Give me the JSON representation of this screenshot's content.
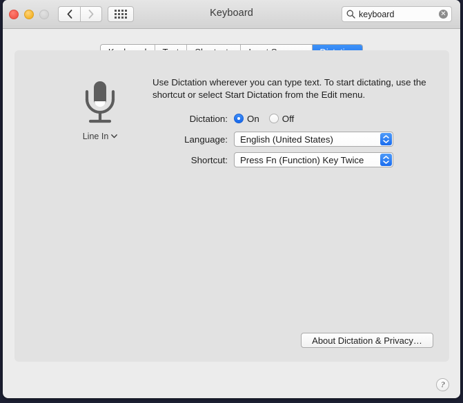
{
  "window": {
    "title": "Keyboard",
    "traffic_lights": [
      "close-button",
      "minimize-button",
      "zoom-button-disabled"
    ],
    "nav": {
      "back_icon": "chevron-left-icon",
      "forward_icon": "chevron-right-icon",
      "grid_icon": "show-all-grid-icon"
    },
    "search": {
      "icon": "search-icon",
      "value": "keyboard",
      "placeholder": "Search",
      "clear_icon": "clear-icon",
      "clear_glyph": "✕"
    }
  },
  "tabs": [
    {
      "label": "Keyboard",
      "active": false
    },
    {
      "label": "Text",
      "active": false
    },
    {
      "label": "Shortcuts",
      "active": false
    },
    {
      "label": "Input Sources",
      "active": false
    },
    {
      "label": "Dictation",
      "active": true
    }
  ],
  "main": {
    "description": "Use Dictation wherever you can type text. To start dictating, use the shortcut or select Start Dictation from the Edit menu.",
    "microphone": {
      "icon": "microphone-icon",
      "source_label": "Line In",
      "chevron": "⌄"
    },
    "fields": {
      "dictation": {
        "label": "Dictation:",
        "options": [
          {
            "label": "On",
            "selected": true
          },
          {
            "label": "Off",
            "selected": false
          }
        ]
      },
      "language": {
        "label": "Language:",
        "value": "English (United States)"
      },
      "shortcut": {
        "label": "Shortcut:",
        "value": "Press Fn (Function) Key Twice"
      }
    },
    "about_button": "About Dictation & Privacy…"
  },
  "help": {
    "label": "?"
  },
  "colors": {
    "accent_blue": "#1a6def",
    "window_bg": "#ececec",
    "panel_bg": "#e2e2e2",
    "titlebar_top": "#e6e6e6",
    "titlebar_bottom": "#d3d3d3"
  }
}
